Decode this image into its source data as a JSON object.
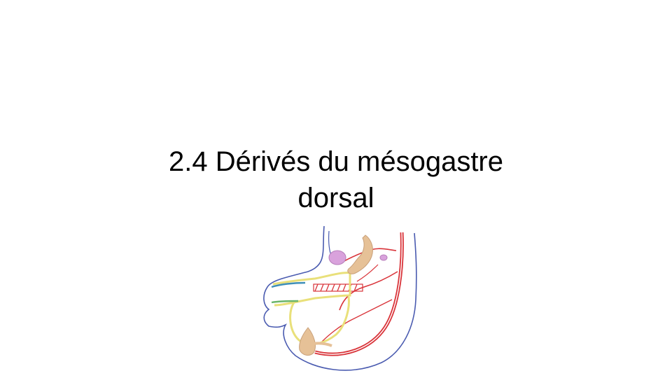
{
  "slide": {
    "title_line1": "2.4 Dérivés du mésogastre",
    "title_line2": "dorsal"
  },
  "colors": {
    "background": "#ffffff",
    "title_text": "#000000",
    "outline_blue": "#4a5bb0",
    "artery_red": "#d9343a",
    "mesentery_yellow": "#e9e07a",
    "organ_tan": "#e6c197",
    "spleen_purple": "#d9a2dc",
    "teal": "#3f8fb8",
    "green": "#6ab56a"
  }
}
